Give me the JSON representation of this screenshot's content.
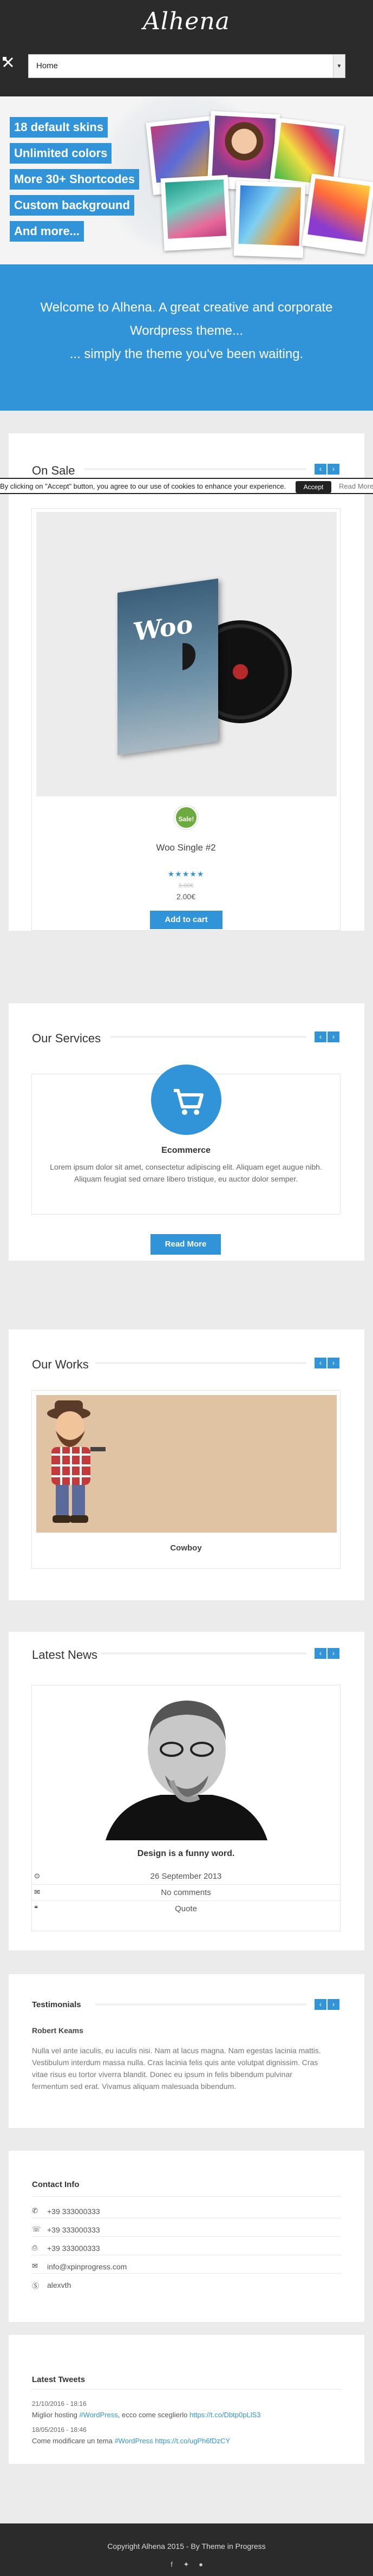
{
  "header": {
    "logo": "Alhena",
    "nav_select": "Home"
  },
  "hero": {
    "tags": [
      "18 default skins",
      "Unlimited colors",
      "More 30+ Shortcodes",
      "Custom background",
      "And more..."
    ]
  },
  "welcome": {
    "line1": "Welcome to Alhena. A great creative and corporate",
    "line2": "Wordpress theme...",
    "line3": "... simply the theme you've been waiting."
  },
  "cookie": {
    "text": "By clicking on \"Accept\" button, you agree to our use of cookies to enhance your experience.",
    "accept": "Accept",
    "more": "Read More"
  },
  "on_sale": {
    "title": "On Sale",
    "product": {
      "image_text": "Woo",
      "badge": "Sale!",
      "name": "Woo Single #2",
      "rating": 5,
      "old_price": "3.00€",
      "price": "2.00€",
      "button": "Add to cart"
    }
  },
  "services": {
    "title": "Our Services",
    "item": {
      "name": "Ecommerce",
      "text_line1": "Lorem ipsum dolor sit amet, consectetur adipiscing elit. Aliquam eget augue nibh.",
      "text_line2": "Aliquam feugiat sed ornare libero tristique, eu auctor dolor semper.",
      "button": "Read More"
    }
  },
  "works": {
    "title": "Our Works",
    "item": {
      "name": "Cowboy"
    }
  },
  "news": {
    "title": "Latest News",
    "item": {
      "title": "Design is a funny word.",
      "date": "26 September 2013",
      "comments": "No comments",
      "format": "Quote"
    }
  },
  "testimonials": {
    "title": "Testimonials",
    "author": "Robert Keams",
    "text": [
      "Nulla vel ante iaculis, eu iaculis nisi. Nam at lacus magna. Nam egestas lacinia mattis.",
      "Vestibulum interdum massa nulla. Cras lacinia felis quis ante volutpat dignissim. Cras",
      "vitae risus eu tortor viverra blandit. Donec eu ipsum in felis bibendum pulvinar",
      "fermentum sed erat. Vivamus aliquam malesuada bibendum."
    ]
  },
  "contact": {
    "title": "Contact Info",
    "rows": [
      {
        "icon": "phone-icon",
        "value": "+39 333000333"
      },
      {
        "icon": "mobile-icon",
        "value": "+39 333000333"
      },
      {
        "icon": "fax-icon",
        "value": "+39 333000333"
      },
      {
        "icon": "email-icon",
        "value": "info@xpinprogress.com"
      },
      {
        "icon": "skype-icon",
        "value": "alexvth"
      }
    ]
  },
  "tweets": {
    "title": "Latest Tweets",
    "items": [
      {
        "date": "21/10/2016 - 18:16",
        "text": "Miglior hosting ",
        "hashtag": "#WordPress",
        "rest": ", ecco come sceglierlo ",
        "link": "https://t.co/Dbtp0pLlS3"
      },
      {
        "date": "18/05/2016 - 18:46",
        "text": "Come modificare un tema ",
        "hashtag": "#WordPress",
        "rest": " ",
        "link": "https://t.co/ugPh6fDzCY"
      }
    ]
  },
  "footer": {
    "text": "Copyright Alhena 2015 - By Theme in Progress",
    "social": [
      "facebook-icon",
      "twitter-icon",
      "github-icon"
    ]
  },
  "colors": {
    "accent": "#3193d8",
    "dark": "#2b2b2b",
    "sale_badge": "#6daa3f"
  }
}
